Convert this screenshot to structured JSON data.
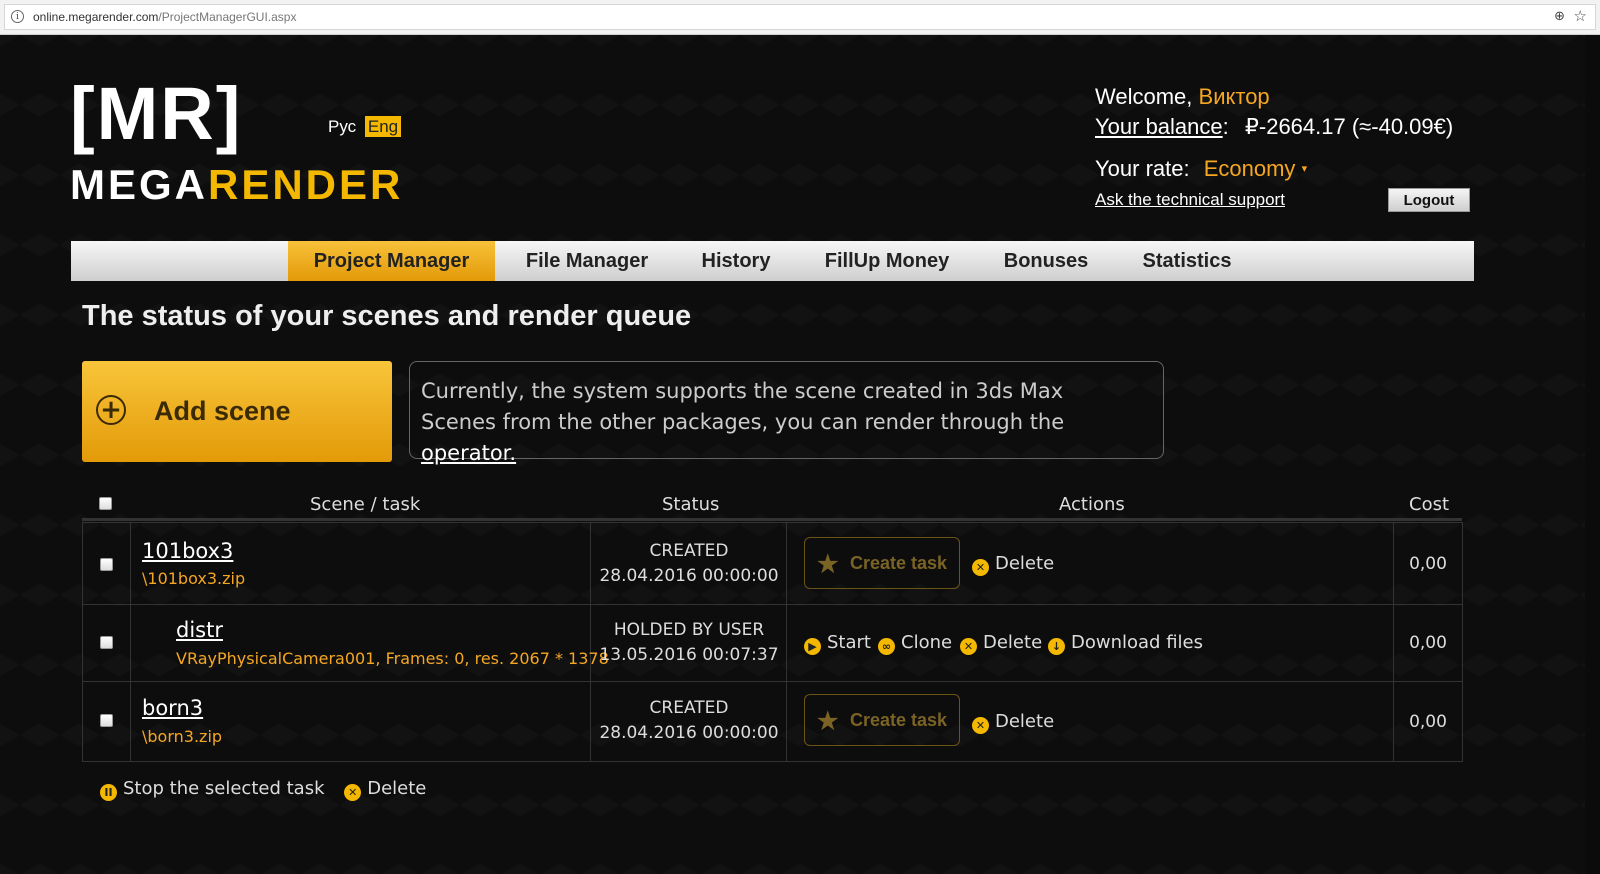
{
  "browser": {
    "url_host": "online.megarender.com",
    "url_path": "/ProjectManagerGUI.aspx",
    "info_icon": "i",
    "zoom_icon": "⊕",
    "star_icon": "☆"
  },
  "logo": {
    "mr": "[MR]",
    "mega": "MEGA",
    "render": "RENDER"
  },
  "lang": {
    "ru": "Рус",
    "en": "Eng"
  },
  "user": {
    "welcome": "Welcome,",
    "name": "Виктор",
    "balance_label": "Your balance",
    "balance_colon": ":",
    "balance_value": "₽-2664.17 (≈-40.09€)",
    "rate_label": "Your rate:",
    "rate_value": "Economy",
    "rate_caret": "▾",
    "support": "Ask the technical support",
    "logout": "Logout"
  },
  "nav": {
    "tabs": [
      "Project Manager",
      "File Manager",
      "History",
      "FillUp Money",
      "Bonuses",
      "Statistics"
    ],
    "active": "Project Manager"
  },
  "page_title": "The status of your scenes and render queue",
  "add_scene": {
    "icon": "+",
    "label": "Add scene"
  },
  "notice": {
    "line1": "Currently, the system supports the scene created in 3ds Max",
    "line2": "Scenes from the other packages, you can render through the",
    "link": "operator."
  },
  "table": {
    "headers": {
      "scene": "Scene / task",
      "status": "Status",
      "actions": "Actions",
      "cost": "Cost"
    },
    "rows": [
      {
        "name": "101box3",
        "sub": "\\101box3.zip",
        "status": "CREATED",
        "date": "28.04.2016 00:00:00",
        "create_task": "Create task",
        "delete": "Delete",
        "cost": "0,00"
      },
      {
        "name": "distr",
        "sub": "VRayPhysicalCamera001, Frames: 0, res. 2067 * 1378",
        "status": "HOLDED BY USER",
        "date": "13.05.2016 00:07:37",
        "start": "Start",
        "clone": "Clone",
        "delete": "Delete",
        "download": "Download files",
        "cost": "0,00"
      },
      {
        "name": "born3",
        "sub": "\\born3.zip",
        "status": "CREATED",
        "date": "28.04.2016 00:00:00",
        "create_task": "Create task",
        "delete": "Delete",
        "cost": "0,00"
      }
    ]
  },
  "footer": {
    "stop": "Stop the selected task",
    "delete": "Delete"
  },
  "icons": {
    "star": "★",
    "delete": "✕",
    "start": "▶",
    "clone": "∞",
    "download": "↓",
    "pause": "II"
  },
  "colors": {
    "accent": "#f5b800",
    "orange_text": "#f5a623",
    "background": "#0d0d0d"
  }
}
